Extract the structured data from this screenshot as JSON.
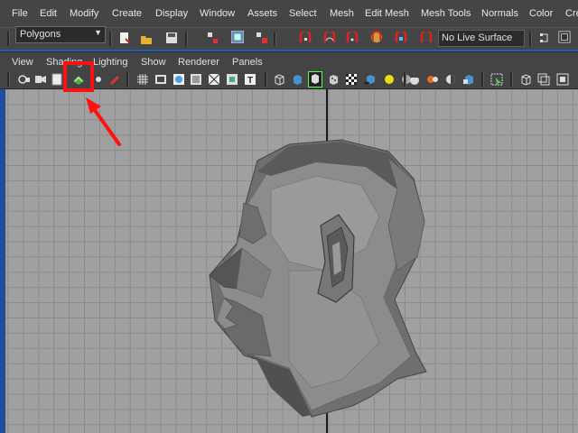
{
  "menubar": {
    "items": [
      "File",
      "Edit",
      "Modify",
      "Create",
      "Display",
      "Window",
      "Assets",
      "Select",
      "Mesh",
      "Edit Mesh",
      "Mesh Tools",
      "Normals",
      "Color",
      "Cre"
    ]
  },
  "statusline": {
    "mode_dropdown": "Polygons",
    "live_surface": "No Live Surface"
  },
  "panel_menu": {
    "items": [
      "View",
      "Shading",
      "Lighting",
      "Show",
      "Renderer",
      "Panels"
    ]
  },
  "annotation": {
    "highlight_color": "#ff1111",
    "arrow_color": "#ff1111"
  },
  "viewport": {
    "background": "#a0a0a0",
    "grid_color": "#8a8a8a",
    "axis_color": "#1a1a1a"
  }
}
